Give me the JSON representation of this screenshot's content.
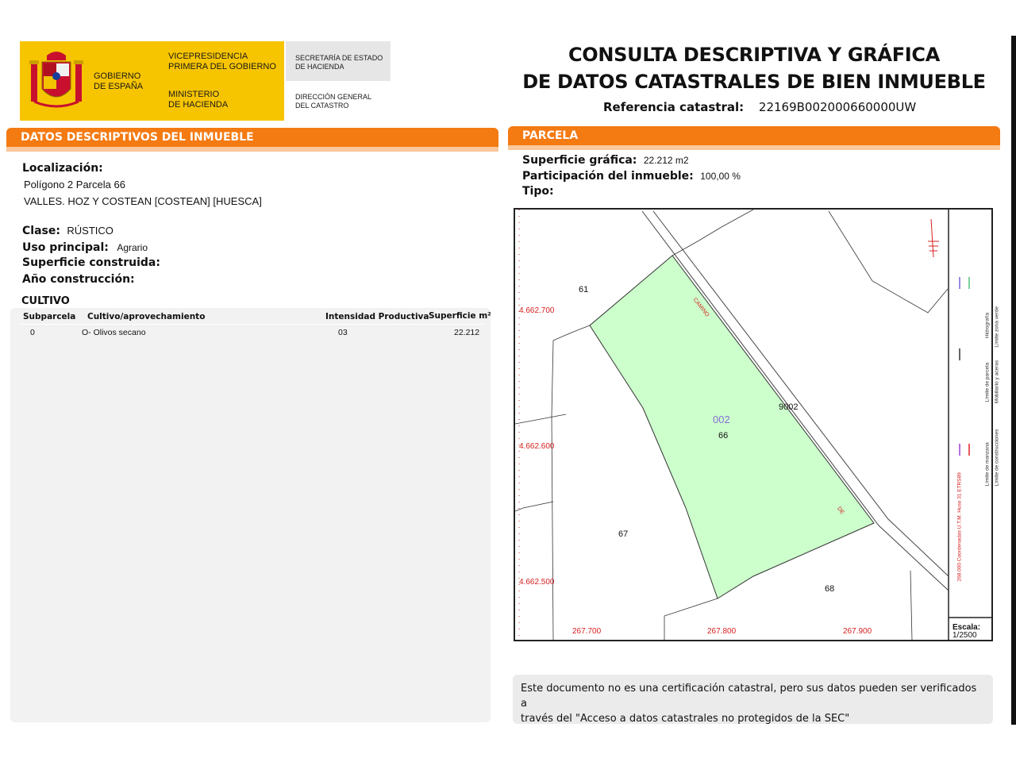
{
  "header": {
    "gobierno": [
      "GOBIERNO",
      "DE ESPAÑA"
    ],
    "vicepresidencia": [
      "VICEPRESIDENCIA",
      "PRIMERA DEL GOBIERNO"
    ],
    "ministerio": [
      "MINISTERIO",
      "DE HACIENDA"
    ],
    "secretaria": [
      "SECRETARÍA DE ESTADO",
      "DE HACIENDA"
    ],
    "direccion": [
      "DIRECCIÓN GENERAL",
      "DEL CATASTRO"
    ],
    "title_line1": "CONSULTA DESCRIPTIVA Y GRÁFICA",
    "title_line2": "DE DATOS CATASTRALES DE BIEN INMUEBLE",
    "ref_label": "Referencia catastral:",
    "ref_value": "22169B002000660000UW"
  },
  "left": {
    "section_title": "DATOS DESCRIPTIVOS DEL INMUEBLE",
    "localizacion_label": "Localización:",
    "localizacion_line1": "Polígono 2 Parcela 66",
    "localizacion_line2": "VALLES. HOZ Y COSTEAN [COSTEAN] [HUESCA]",
    "clase_label": "Clase:",
    "clase_value": "RÚSTICO",
    "uso_label": "Uso principal:",
    "uso_value": "Agrario",
    "superficie_label": "Superficie construida:",
    "anio_label": "Año construcción:",
    "cultivo_title": "CULTIVO",
    "table_headers": [
      "Subparcela",
      "Cultivo/aprovechamiento",
      "Intensidad Productiva",
      "Superficie m²"
    ],
    "table_row": [
      "0",
      "O- Olivos secano",
      "03",
      "22.212"
    ]
  },
  "right": {
    "section_title": "PARCELA",
    "sup_grafica_label": "Superficie gráfica:",
    "sup_grafica_value": "22.212 m2",
    "participacion_label": "Participación del inmueble:",
    "participacion_value": "100,00 %",
    "tipo_label": "Tipo:",
    "notice_line1": "Este documento no es una certificación catastral, pero sus datos pueden ser verificados a",
    "notice_line2": "través del \"Acceso a datos catastrales no protegidos de la SEC\""
  },
  "map": {
    "y_ticks": [
      "4.662.700",
      "4.662.600",
      "4.662.500"
    ],
    "x_ticks": [
      "267.700",
      "267.800",
      "267.900"
    ],
    "parcel_labels": [
      "61",
      "67",
      "68",
      "9002"
    ],
    "subparcel_code": "002",
    "parcel_number": "66",
    "road_text_1": "CAMINO",
    "road_text_2": "DE",
    "legend_1": "Límite de parcela",
    "legend_2": "Mobiliario y aceras",
    "legend_3": "Límite zona verde",
    "legend_4": "Hidrografía",
    "legend_5": "Límite de manzana",
    "legend_6": "Límite de construcciones",
    "coords_label": "Coordenadas U.T.M. Huso 31 ETRS89",
    "coords_prefix": "268.000",
    "scale_label": "Escala:",
    "scale_value": "1/2500",
    "parcel_fill": "#ccffcc",
    "tick_color": "#d62020"
  }
}
